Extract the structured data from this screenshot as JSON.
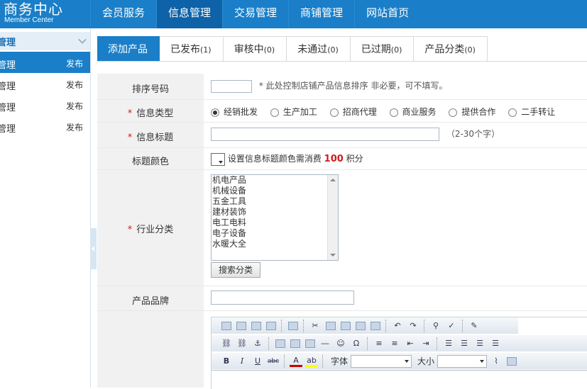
{
  "brand": {
    "title": "商务中心",
    "subtitle": "Member Center"
  },
  "nav": [
    "会员服务",
    "信息管理",
    "交易管理",
    "商铺管理",
    "网站首页"
  ],
  "nav_active": "信息管理",
  "sidebar": {
    "head": "管理",
    "items": [
      {
        "label": "管理",
        "action": "发布"
      },
      {
        "label": "管理",
        "action": "发布"
      },
      {
        "label": "管理",
        "action": "发布"
      },
      {
        "label": "管理",
        "action": "发布"
      }
    ]
  },
  "tabs": [
    {
      "label": "添加产品",
      "count": ""
    },
    {
      "label": "已发布",
      "count": "(1)"
    },
    {
      "label": "审核中",
      "count": "(0)"
    },
    {
      "label": "未通过",
      "count": "(0)"
    },
    {
      "label": "已过期",
      "count": "(0)"
    },
    {
      "label": "产品分类",
      "count": "(0)"
    }
  ],
  "form": {
    "sort": {
      "label": "排序号码",
      "hint": "* 此处控制店铺产品信息排序 非必要，可不填写。",
      "value": ""
    },
    "type": {
      "label": "信息类型",
      "options": [
        "经销批发",
        "生产加工",
        "招商代理",
        "商业服务",
        "提供合作",
        "二手转让"
      ],
      "selected": "经销批发"
    },
    "title": {
      "label": "信息标题",
      "hint": "（2-30个字）",
      "value": ""
    },
    "color": {
      "label": "标题颜色",
      "text_before": "设置信息标题颜色需消费",
      "points": "100",
      "text_after": "积分"
    },
    "industry": {
      "label": "行业分类",
      "options": [
        "机电产品",
        "机械设备",
        "五金工具",
        "建材装饰",
        "电工电料",
        "电子设备",
        "水暖大全"
      ],
      "button": "搜索分类"
    },
    "brand": {
      "label": "产品品牌",
      "value": ""
    }
  },
  "editor": {
    "font_label": "字体",
    "size_label": "大小",
    "toolbar_row1": [
      "paste-icon",
      "paste-text-icon",
      "paste-word-icon",
      "print-icon",
      "preview-icon",
      "cut-icon",
      "copy-icon",
      "paste2-icon",
      "paste3-icon",
      "paste4-icon",
      "undo-icon",
      "redo-icon",
      "find-icon",
      "spellcheck-icon",
      "eraser-icon"
    ],
    "toolbar_row2": [
      "link-icon",
      "unlink-icon",
      "anchor-icon",
      "image-icon",
      "flash-icon",
      "table-icon",
      "hr-icon",
      "smiley-icon",
      "special-char-icon",
      "ordered-list-icon",
      "unordered-list-icon",
      "outdent-icon",
      "indent-icon",
      "align-left-icon",
      "align-center-icon",
      "align-right-icon",
      "justify-icon"
    ],
    "toolbar_row3_labels": {
      "bold": "B",
      "italic": "I",
      "underline": "U",
      "strike": "abc",
      "fontcolor": "A",
      "bgcolor": "ab"
    }
  }
}
